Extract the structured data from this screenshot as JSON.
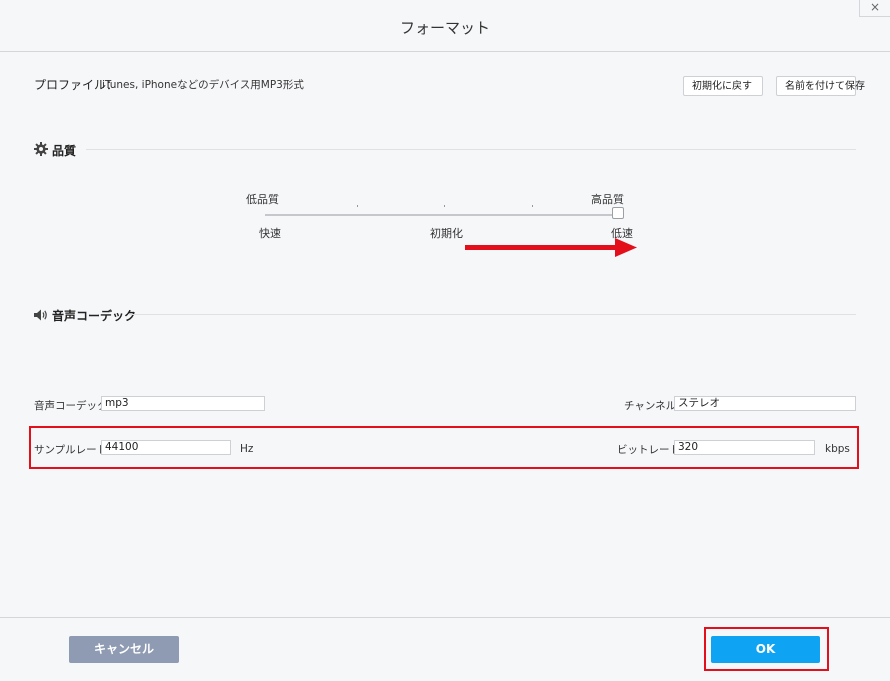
{
  "window": {
    "title": "フォーマット",
    "close_glyph": "×"
  },
  "profile": {
    "label": "プロファイル：",
    "value": "iTunes, iPhoneなどのデバイス用MP3形式",
    "reset_label": "初期化に戻す",
    "saveas_label": "名前を付けて保存"
  },
  "quality": {
    "title": "品質",
    "icon": "gear-icon",
    "top_left": "低品質",
    "top_right": "高品質",
    "bottom_left": "快速",
    "bottom_center": "初期化",
    "bottom_right": "低速",
    "slider_value": 1.0
  },
  "codec": {
    "title": "音声コーデック",
    "icon": "speaker-icon",
    "codec_label": "音声コーデック:",
    "codec_value": "mp3",
    "channel_label": "チャンネル:",
    "channel_value": "ステレオ",
    "samplerate_label": "サンプルレート:",
    "samplerate_value": "44100",
    "samplerate_unit": "Hz",
    "bitrate_label": "ビットレート:",
    "bitrate_value": "320",
    "bitrate_unit": "kbps"
  },
  "footer": {
    "cancel_label": "キャンセル",
    "ok_label": "OK"
  },
  "colors": {
    "accent": "#0fa4f3",
    "cancel": "#8f9ab3",
    "annotation": "#e3101c"
  }
}
